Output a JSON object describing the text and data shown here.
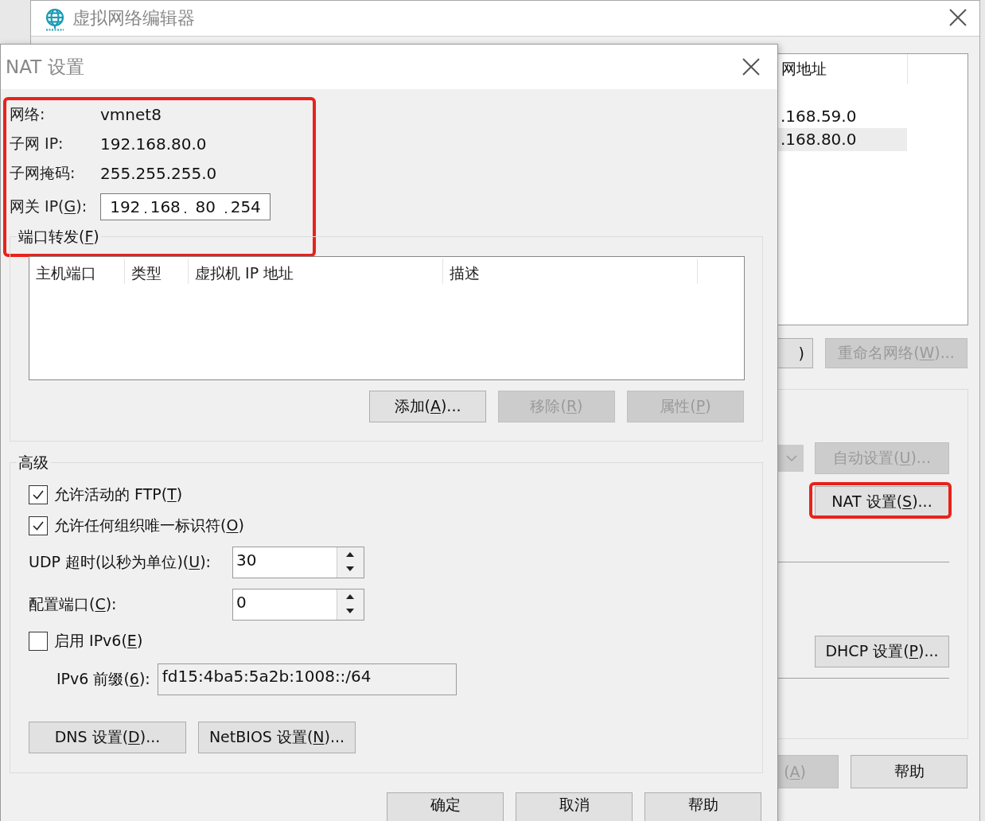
{
  "editor_window": {
    "title": "虚拟网络编辑器",
    "list": {
      "column": "网地址",
      "rows": [
        {
          "text": ".168.59.0",
          "selected": false
        },
        {
          "text": ".168.80.0",
          "selected": true
        }
      ]
    },
    "list_buttons": [
      {
        "label": {
          "pre": ")"
        },
        "disabled": false
      },
      {
        "label": {
          "pre": "重命名网络(",
          "key": "W",
          "post": ")..."
        },
        "disabled": true
      }
    ],
    "auto_setup_button": {
      "label": {
        "pre": "自动设置(",
        "key": "U",
        "post": ")..."
      },
      "disabled": true
    },
    "nat_button": {
      "label": {
        "pre": "NAT 设置(",
        "key": "S",
        "post": ")..."
      },
      "disabled": false,
      "highlighted": true
    },
    "dhcp_button": {
      "label": {
        "pre": "DHCP 设置(",
        "key": "P",
        "post": ")..."
      },
      "disabled": false
    },
    "bottom_buttons": [
      {
        "label": {
          "pre": "(",
          "key": "A",
          "post": ")"
        },
        "disabled": true
      },
      {
        "label": {
          "pre": "帮助"
        },
        "disabled": false
      }
    ]
  },
  "dialog": {
    "title": "NAT 设置",
    "info_highlighted": true,
    "info": [
      {
        "label": "网络:",
        "value": "vmnet8"
      },
      {
        "label": "子网 IP:",
        "value": "192.168.80.0"
      },
      {
        "label": "子网掩码:",
        "value": "255.255.255.0"
      }
    ],
    "gateway": {
      "label": {
        "pre": "网关 IP(",
        "key": "G",
        "post": "):"
      },
      "octets": [
        "192",
        "168",
        "80",
        "254"
      ]
    },
    "port_forwarding": {
      "title": {
        "pre": "端口转发(",
        "key": "F",
        "post": ")"
      },
      "columns": [
        "主机端口",
        "类型",
        "虚拟机 IP 地址",
        "描述"
      ],
      "buttons": [
        {
          "label": {
            "pre": "添加(",
            "key": "A",
            "post": ")..."
          },
          "disabled": false
        },
        {
          "label": {
            "pre": "移除(",
            "key": "R",
            "post": ")"
          },
          "disabled": true
        },
        {
          "label": {
            "pre": "属性(",
            "key": "P",
            "post": ")"
          },
          "disabled": true
        }
      ]
    },
    "advanced": {
      "title": "高级",
      "options": [
        {
          "kind": "checkbox",
          "label": {
            "pre": "允许活动的 FTP(",
            "key": "T",
            "post": ")"
          },
          "checked": true
        },
        {
          "kind": "checkbox",
          "label": {
            "pre": "允许任何组织唯一标识符(",
            "key": "O",
            "post": ")"
          },
          "checked": true
        },
        {
          "kind": "spinner",
          "label": {
            "pre": "UDP 超时(以秒为单位)(",
            "key": "U",
            "post": "):"
          },
          "value": "30"
        },
        {
          "kind": "spinner",
          "label": {
            "pre": "配置端口(",
            "key": "C",
            "post": "):"
          },
          "value": "0"
        },
        {
          "kind": "checkbox",
          "label": {
            "pre": "启用 IPv6(",
            "key": "E",
            "post": ")"
          },
          "checked": false
        },
        {
          "kind": "text",
          "label": {
            "pre": "IPv6 前缀(",
            "key": "6",
            "post": "):"
          },
          "value": "fd15:4ba5:5a2b:1008::/64",
          "disabled": true
        }
      ],
      "buttons": [
        {
          "label": {
            "pre": "DNS 设置(",
            "key": "D",
            "post": ")..."
          },
          "disabled": false
        },
        {
          "label": {
            "pre": "NetBIOS 设置(",
            "key": "N",
            "post": ")..."
          },
          "disabled": false
        }
      ]
    },
    "buttons": [
      {
        "label": {
          "pre": "确定"
        },
        "disabled": false
      },
      {
        "label": {
          "pre": "取消"
        },
        "disabled": false
      },
      {
        "label": {
          "pre": "帮助"
        },
        "disabled": false
      }
    ]
  }
}
